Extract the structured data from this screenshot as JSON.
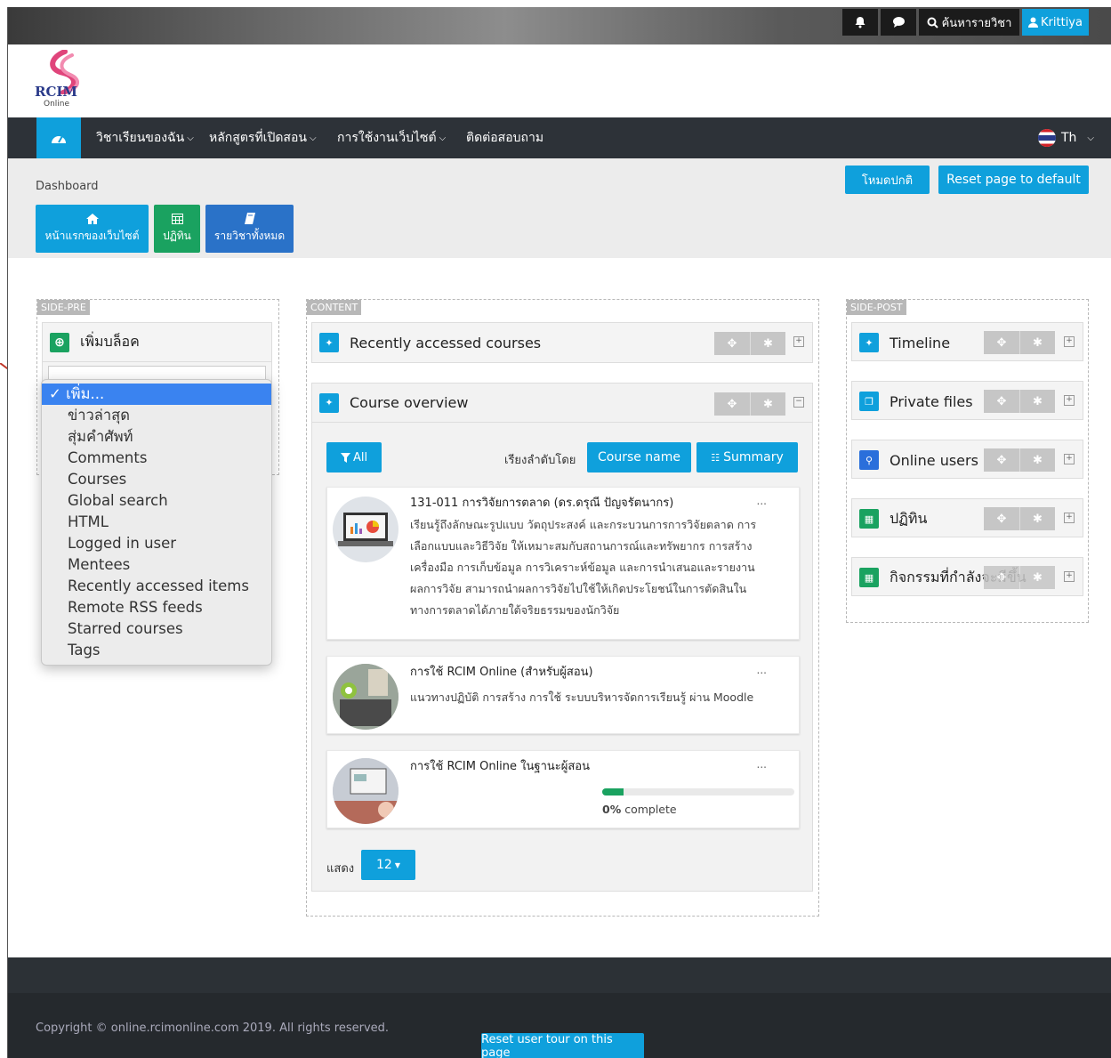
{
  "topbar": {
    "bell_icon": "bell-icon",
    "chat_icon": "chat-icon",
    "search_label": "ค้นหารายวิชา",
    "user_name": "Krittiya"
  },
  "logo": {
    "text_main": "RCIM",
    "text_sub": "Online"
  },
  "nav": {
    "items": [
      "วิชาเรียนของฉัน",
      "หลักสูตรที่เปิดสอน",
      "การใช้งานเว็บไซต์",
      "ติดต่อสอบถาม"
    ],
    "language": "Th"
  },
  "breadcrumb": "Dashboard",
  "buttons": {
    "normal_mode": "โหมดปกติ",
    "reset_page": "Reset page to default"
  },
  "quick_links": [
    {
      "label": "หน้าแรกของเว็บไซต์",
      "icon": "home-icon"
    },
    {
      "label": "ปฏิทิน",
      "icon": "calendar-icon"
    },
    {
      "label": "รายวิชาทั้งหมด",
      "icon": "book-icon"
    }
  ],
  "regions": {
    "pre": "SIDE-PRE",
    "content": "CONTENT",
    "post": "SIDE-POST"
  },
  "add_block": {
    "title": "เพิ่มบล็อค"
  },
  "dropdown": {
    "items": [
      "เพิ่ม...",
      "ข่าวล่าสุด",
      "สุ่มคำศัพท์",
      "Comments",
      "Courses",
      "Global search",
      "HTML",
      "Logged in user",
      "Mentees",
      "Recently accessed items",
      "Remote RSS feeds",
      "Starred courses",
      "Tags"
    ]
  },
  "content": {
    "recent_title": "Recently accessed courses",
    "overview_title": "Course overview",
    "filter_label": "All",
    "sort_label": "เรียงลำดับโดย",
    "sort_button": "Course name",
    "view_button": "Summary",
    "courses": [
      {
        "title": "131-011 การวิจัยการตลาด (ดร.ดรุณี ปัญจรัตนากร)",
        "desc": [
          "เรียนรู้ถึงลักษณะรูปแบบ วัตถุประสงค์ และกระบวนการการวิจัยตลาด การ",
          "เลือกแบบและวิธีวิจัย ให้เหมาะสมกับสถานการณ์และทรัพยากร การสร้าง",
          "เครื่องมือ การเก็บข้อมูล การวิเคราะห์ข้อมูล และการนำเสนอและรายงาน",
          "ผลการวิจัย สามารถนำผลการวิจัยไปใช้ให้เกิดประโยชน์ในการตัดสินใน",
          "ทางการตลาดได้ภายใต้จริยธรรมของนักวิจัย"
        ]
      },
      {
        "title": "การใช้ RCIM Online (สำหรับผู้สอน)",
        "desc": [
          "แนวทางปฏิบัติ การสร้าง การใช้ ระบบบริหารจัดการเรียนรู้ ผ่าน Moodle"
        ]
      },
      {
        "title": "การใช้ RCIM Online ในฐานะผู้สอน",
        "progress": 0,
        "progress_pct": "0%",
        "progress_suffix": " complete"
      }
    ],
    "more": "...",
    "show_label": "แสดง",
    "show_value": "12"
  },
  "side_post": [
    {
      "title": "Timeline",
      "icon": "pin-icon",
      "color": "#0fa0dc"
    },
    {
      "title": "Private files",
      "icon": "files-icon",
      "color": "#0fa0dc"
    },
    {
      "title": "Online users",
      "icon": "user-icon",
      "color": "#2a6fdb"
    },
    {
      "title": "ปฏิทิน",
      "icon": "calendar-icon",
      "color": "#1aa260"
    },
    {
      "title": "กิจกรรมที่กำลังจะมีขึ้น",
      "icon": "calendar-icon",
      "color": "#1aa260"
    }
  ],
  "footer": {
    "copyright": "Copyright © online.rcimonline.com 2019. All rights reserved.",
    "tour_button": "Reset user tour on this page"
  },
  "colors": {
    "accent": "#0fa0dc",
    "green": "#1aa260",
    "navbar": "#2d3238",
    "footer": "#25292d",
    "annotation_arrow": "#c0392b"
  }
}
